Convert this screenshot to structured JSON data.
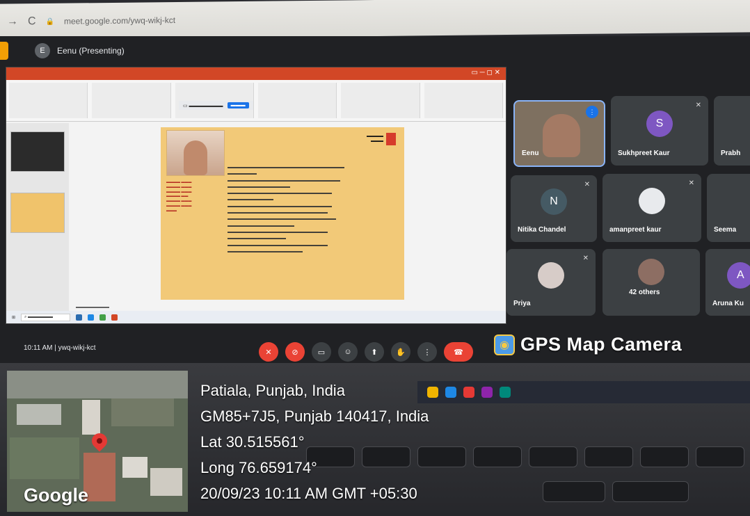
{
  "browser": {
    "url": "meet.google.com/ywq-wikj-kct"
  },
  "meet": {
    "presenter_initial": "E",
    "presenter_label": "Eenu (Presenting)",
    "meeting_info": "10:11 AM  |  ywq-wikj-kct"
  },
  "participants": [
    {
      "name": "Eenu"
    },
    {
      "name": "Sukhpreet Kaur",
      "initial": "S"
    },
    {
      "name": "Prabh"
    },
    {
      "name": "Nitika Chandel",
      "initial": "N"
    },
    {
      "name": "amanpreet kaur"
    },
    {
      "name": "Seema"
    },
    {
      "name": "Priya"
    },
    {
      "name": "42 others"
    },
    {
      "name": "Aruna Ku",
      "initial": "A"
    }
  ],
  "colors": {
    "accent": "#1a73e8",
    "end_call": "#ea4335",
    "presenting_tab": "#f29f05"
  },
  "gps": {
    "app_title": "GPS Map Camera",
    "location": "Patiala, Punjab, India",
    "address": "GM85+7J5, Punjab 140417, India",
    "lat": "Lat 30.515561°",
    "long": "Long 76.659174°",
    "datetime": "20/09/23 10:11 AM GMT +05:30",
    "map_provider": "Google"
  }
}
